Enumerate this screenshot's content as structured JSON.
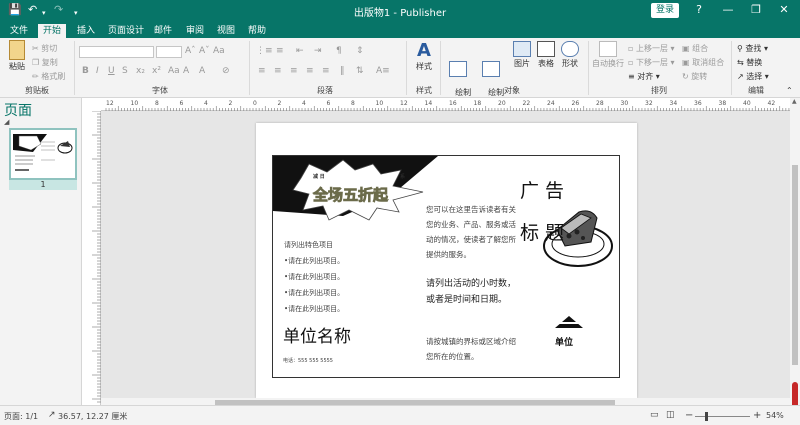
{
  "window": {
    "title": "出版物1 - Publisher",
    "login_label": "登录",
    "help_label": "?"
  },
  "tabs": [
    {
      "label": "文件"
    },
    {
      "label": "开始"
    },
    {
      "label": "插入"
    },
    {
      "label": "页面设计"
    },
    {
      "label": "邮件"
    },
    {
      "label": "审阅"
    },
    {
      "label": "视图"
    },
    {
      "label": "帮助"
    }
  ],
  "ribbon": {
    "clipboard": {
      "label": "剪贴板",
      "paste": "粘贴",
      "cut": "剪切",
      "copy": "复制",
      "format_painter": "格式刷"
    },
    "font": {
      "label": "字体"
    },
    "paragraph": {
      "label": "段落"
    },
    "styles": {
      "label": "样式",
      "styles_btn": "样式"
    },
    "objects": {
      "label": "对象",
      "draw_textbox": "绘制\n文本框",
      "draw_vertical_textbox": "绘制\n竖排文本框",
      "picture": "图片",
      "table": "表格",
      "shapes": "形状"
    },
    "arrange": {
      "label": "排列",
      "auto_wrap": "自动换行",
      "bring_forward": "上移一层",
      "send_backward": "下移一层",
      "align": "对齐",
      "group": "组合",
      "ungroup": "取消组合",
      "rotate": "旋转"
    },
    "editing": {
      "label": "编辑",
      "find": "查找",
      "replace": "替换",
      "select": "选择"
    }
  },
  "pages_pane": {
    "title": "页面",
    "page_number": "1"
  },
  "flyer": {
    "burst_top_left": "减 日",
    "burst_top_right": "系",
    "burst_text": "全场五折起",
    "ad_title_1": "广 告",
    "ad_title_2": "标 题",
    "features_heading": "请列出特色项目",
    "list_items": [
      "•请在此列出项目。",
      "•请在此列出项目。",
      "•请在此列出项目。",
      "•请在此列出项目。"
    ],
    "org_name": "单位名称",
    "phone": "电话：555 555 5555",
    "body_1": "您可以在这里告诉读者有关您的业务、产品、服务或活动的情况，使读者了解您所提供的服务。",
    "body_2": "请列出活动的小时数，或者是时间和日期。",
    "body_3": "请按城镇的界标或区域介绍您所在的位置。",
    "logo_text": "单位"
  },
  "status": {
    "page": "页面: 1/1",
    "position": "36.57, 12.27 厘米",
    "zoom": "54%"
  },
  "ruler": {
    "h_ticks": [
      "12",
      "10",
      "8",
      "6",
      "4",
      "2",
      "0",
      "2",
      "4",
      "6",
      "8",
      "10",
      "12",
      "14",
      "16",
      "18",
      "20",
      "22",
      "24",
      "26",
      "28",
      "30",
      "32",
      "34",
      "36",
      "38",
      "40",
      "42"
    ]
  },
  "colors": {
    "accent": "#077568"
  }
}
